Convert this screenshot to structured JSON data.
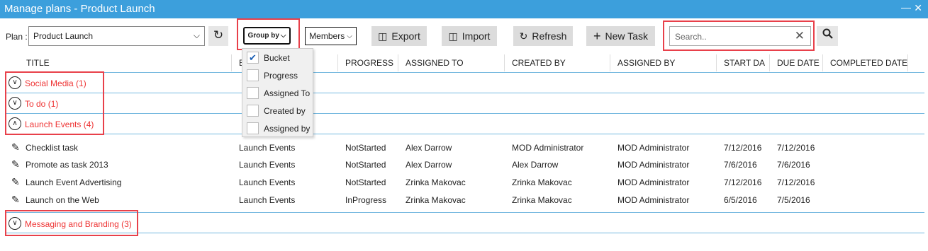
{
  "window": {
    "title": "Manage plans - Product Launch",
    "minimize": "―",
    "close": "✕"
  },
  "toolbar": {
    "plan_label": "Plan :",
    "plan_value": "Product Launch",
    "group_by_label": "Group by",
    "members_label": "Members",
    "export_label": "Export",
    "import_label": "Import",
    "refresh_label": "Refresh",
    "new_task_label": "New Task",
    "search_placeholder": "Search.."
  },
  "group_by_menu": [
    {
      "label": "Bucket",
      "checked": true
    },
    {
      "label": "Progress",
      "checked": false
    },
    {
      "label": "Assigned To",
      "checked": false
    },
    {
      "label": "Created by",
      "checked": false
    },
    {
      "label": "Assigned by",
      "checked": false
    }
  ],
  "columns": [
    "TITLE",
    "B",
    "PROGRESS",
    "ASSIGNED TO",
    "CREATED BY",
    "ASSIGNED BY",
    "START DA",
    "DUE DATE",
    "COMPLETED DATE"
  ],
  "groups": [
    {
      "name": "Social Media",
      "count": "(1)",
      "expanded": false
    },
    {
      "name": "To do",
      "count": "(1)",
      "expanded": false
    },
    {
      "name": "Launch Events",
      "count": "(4)",
      "expanded": true
    },
    {
      "name": "Messaging and Branding",
      "count": "(3)",
      "expanded": false
    }
  ],
  "tasks": [
    {
      "title": "Checklist task",
      "bucket": "Launch Events",
      "progress": "NotStarted",
      "assigned_to": "Alex Darrow",
      "created_by": "MOD Administrator",
      "assigned_by": "MOD Administrator",
      "start": "7/12/2016",
      "due": "7/12/2016"
    },
    {
      "title": "Promote as task 2013",
      "bucket": "Launch Events",
      "progress": "NotStarted",
      "assigned_to": "Alex Darrow",
      "created_by": "Alex Darrow",
      "assigned_by": "MOD Administrator",
      "start": "7/6/2016",
      "due": "7/6/2016"
    },
    {
      "title": "Launch Event Advertising",
      "bucket": "Launch Events",
      "progress": "NotStarted",
      "assigned_to": "Zrinka Makovac",
      "created_by": "Zrinka Makovac",
      "assigned_by": "MOD Administrator",
      "start": "7/12/2016",
      "due": "7/12/2016"
    },
    {
      "title": "Launch on the Web",
      "bucket": "Launch Events",
      "progress": "InProgress",
      "assigned_to": "Zrinka Makovac",
      "created_by": "Zrinka Makovac",
      "assigned_by": "MOD Administrator",
      "start": "6/5/2016",
      "due": "7/5/2016"
    }
  ],
  "icons": {
    "refresh": "↻",
    "search": "⌕",
    "clear": "✕",
    "edit": "✎",
    "plus": "+",
    "doc": "🗎"
  },
  "colors": {
    "titlebar": "#3c9fdc",
    "group_text": "#e33333",
    "highlight": "#e8404a",
    "divider": "#74b8df"
  }
}
